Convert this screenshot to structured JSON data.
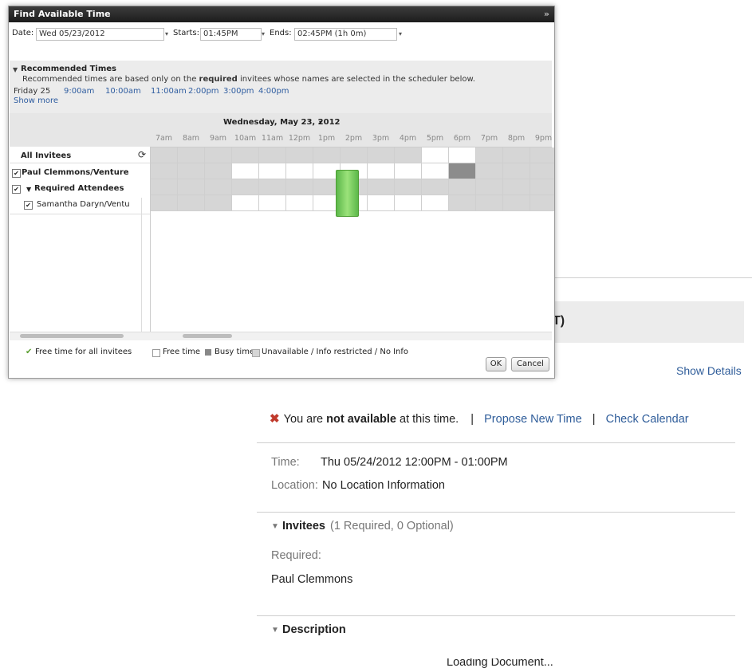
{
  "dialog": {
    "title": "Find Available Time",
    "close_glyph": "»",
    "date_label": "Date:",
    "date_value": "Wed 05/23/2012",
    "starts_label": "Starts:",
    "starts_value": "01:45PM",
    "ends_label": "Ends:",
    "ends_value": "02:45PM (1h 0m)",
    "dropdown_glyph": "▾"
  },
  "recommended": {
    "header": "Recommended Times",
    "desc_before": "Recommended times are based only on the ",
    "desc_bold": "required",
    "desc_after": " invitees whose names are selected in the scheduler below.",
    "day": "Friday 25",
    "times": [
      "9:00am",
      "10:00am",
      "11:00am",
      "2:00pm",
      "3:00pm",
      "4:00pm"
    ],
    "show_more": "Show more"
  },
  "scheduler": {
    "date_heading": "Wednesday, May 23, 2012",
    "hours": [
      "7am",
      "8am",
      "9am",
      "10am",
      "11am",
      "12pm",
      "1pm",
      "2pm",
      "3pm",
      "4pm",
      "5pm",
      "6pm",
      "7pm",
      "8pm",
      "9pm"
    ],
    "all_invitees": "All Invitees",
    "rows": [
      {
        "label": "Paul Clemmons/Venture",
        "checked": true
      },
      {
        "label": "Required Attendees",
        "checked": true
      },
      {
        "label": "Samantha Daryn/Ventu",
        "checked": true
      }
    ],
    "colors": {
      "unavailable": "#d6d6d6",
      "busy": "#8c8c8c",
      "free_all": "#7ccc5a",
      "free": "#ffffff"
    }
  },
  "legend": {
    "free_all": "Free time for all invitees",
    "free": "Free time",
    "busy": "Busy time",
    "unavailable": "Unavailable / Info restricted / No Info"
  },
  "buttons": {
    "ok": "OK",
    "cancel": "Cancel"
  },
  "meeting": {
    "header_fragment": "T)",
    "show_details": "Show Details",
    "not_avail_prefix": "You are ",
    "not_avail_bold": "not available",
    "not_avail_suffix": " at this time.",
    "separator": "|",
    "propose_link": "Propose New Time",
    "check_link": "Check Calendar",
    "time_label": "Time:",
    "time_value": "Thu 05/24/2012 12:00PM - 01:00PM",
    "location_label": "Location:",
    "location_value": "No Location Information",
    "invitees_heading": "Invitees",
    "invitees_count": "(1 Required, 0 Optional)",
    "required_label": "Required:",
    "required_name": "Paul Clemmons",
    "description_heading": "Description",
    "loading_text": "Loading Document..."
  }
}
